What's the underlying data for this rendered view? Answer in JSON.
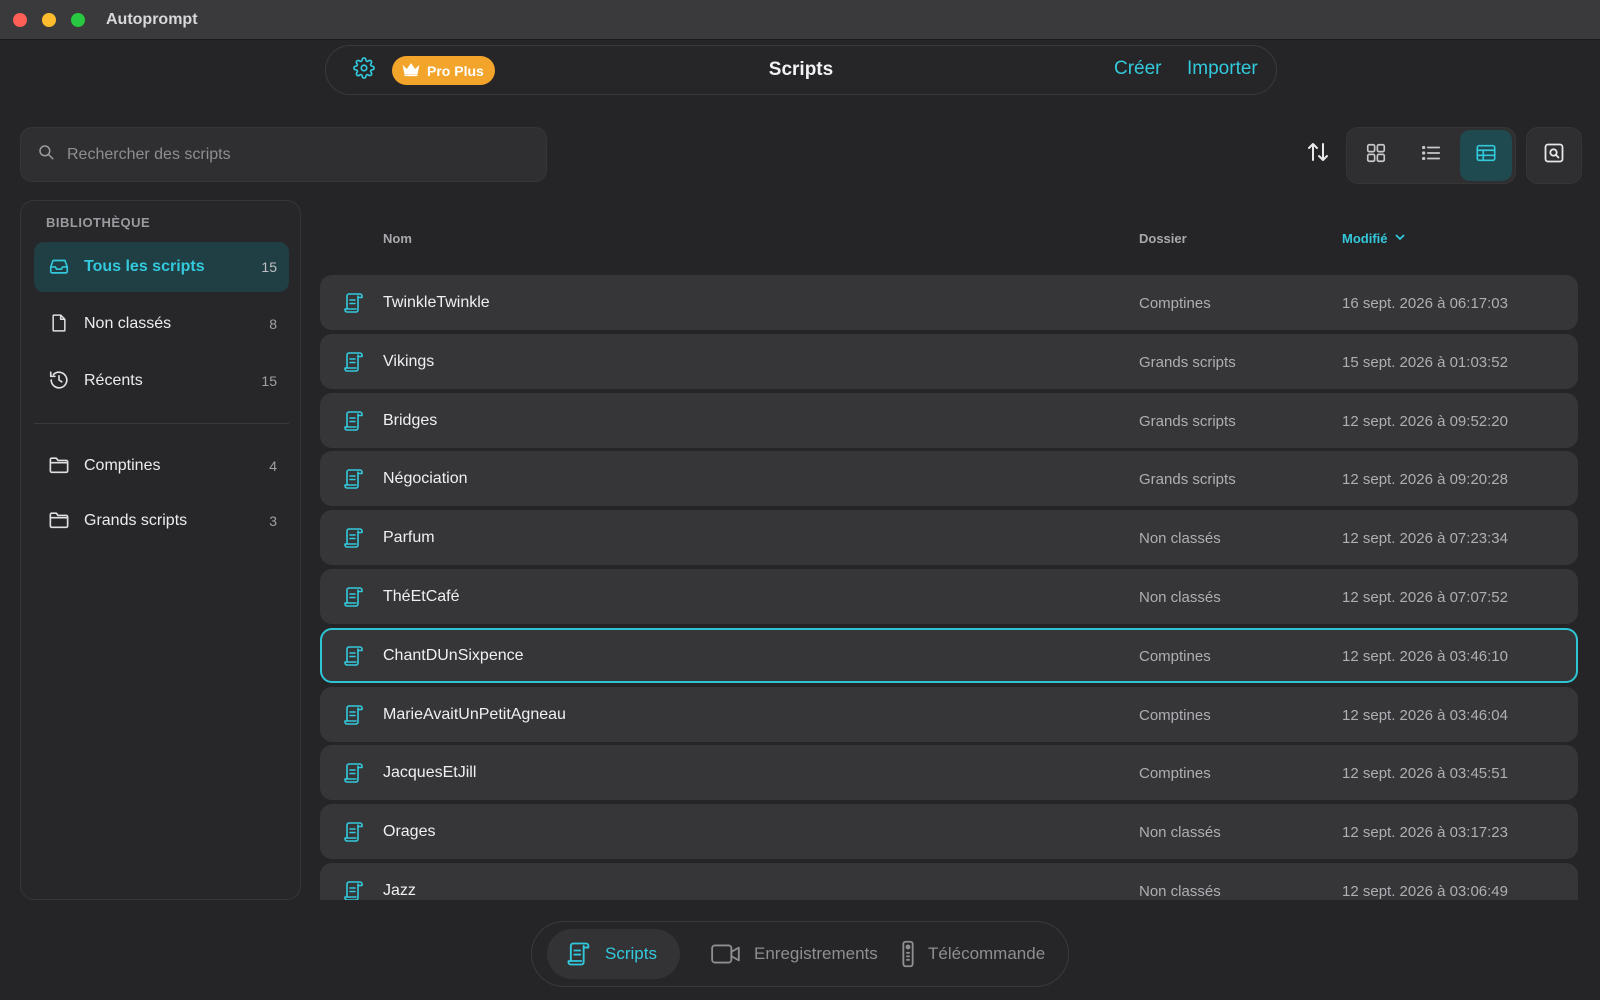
{
  "window": {
    "title": "Autoprompt"
  },
  "header": {
    "badge": "Pro Plus",
    "title": "Scripts",
    "create_label": "Créer",
    "import_label": "Importer"
  },
  "search": {
    "placeholder": "Rechercher des scripts",
    "value": ""
  },
  "sidebar": {
    "heading": "BIBLIOTHÈQUE",
    "library": [
      {
        "label": "Tous les scripts",
        "count": "15",
        "icon": "inbox-icon",
        "active": true
      },
      {
        "label": "Non classés",
        "count": "8",
        "icon": "document-icon",
        "active": false
      },
      {
        "label": "Récents",
        "count": "15",
        "icon": "history-icon",
        "active": false
      }
    ],
    "folders": [
      {
        "label": "Comptines",
        "count": "4",
        "icon": "folder-icon"
      },
      {
        "label": "Grands scripts",
        "count": "3",
        "icon": "folder-icon"
      }
    ]
  },
  "table": {
    "columns": {
      "name": "Nom",
      "folder": "Dossier",
      "modified": "Modifié"
    },
    "rows": [
      {
        "name": "TwinkleTwinkle",
        "folder": "Comptines",
        "modified": "16 sept. 2026 à 06:17:03"
      },
      {
        "name": "Vikings",
        "folder": "Grands scripts",
        "modified": "15 sept. 2026 à 01:03:52"
      },
      {
        "name": "Bridges",
        "folder": "Grands scripts",
        "modified": "12 sept. 2026 à 09:52:20"
      },
      {
        "name": "Négociation",
        "folder": "Grands scripts",
        "modified": "12 sept. 2026 à 09:20:28"
      },
      {
        "name": "Parfum",
        "folder": "Non classés",
        "modified": "12 sept. 2026 à 07:23:34"
      },
      {
        "name": "ThéEtCafé",
        "folder": "Non classés",
        "modified": "12 sept. 2026 à 07:07:52"
      },
      {
        "name": "ChantDUnSixpence",
        "folder": "Comptines",
        "modified": "12 sept. 2026 à 03:46:10",
        "selected": true
      },
      {
        "name": "MarieAvaitUnPetitAgneau",
        "folder": "Comptines",
        "modified": "12 sept. 2026 à 03:46:04"
      },
      {
        "name": "JacquesEtJill",
        "folder": "Comptines",
        "modified": "12 sept. 2026 à 03:45:51"
      },
      {
        "name": "Orages",
        "folder": "Non classés",
        "modified": "12 sept. 2026 à 03:17:23"
      },
      {
        "name": "Jazz",
        "folder": "Non classés",
        "modified": "12 sept. 2026 à 03:06:49"
      }
    ]
  },
  "tabbar": {
    "tabs": [
      {
        "label": "Scripts",
        "icon": "script-icon",
        "active": true
      },
      {
        "label": "Enregistrements",
        "icon": "video-camera-icon",
        "active": false
      },
      {
        "label": "Télécommande",
        "icon": "remote-icon",
        "active": false
      }
    ]
  },
  "colors": {
    "accent": "#33c9dc",
    "badge": "#f2a42b",
    "row_bg": "#363638",
    "window_bg": "#252527"
  }
}
